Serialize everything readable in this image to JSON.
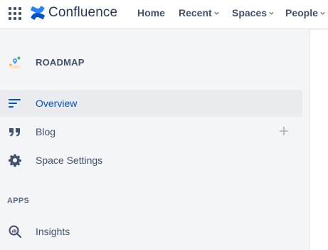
{
  "topbar": {
    "app_name": "Confluence",
    "nav": {
      "home": "Home",
      "recent": "Recent",
      "spaces": "Spaces",
      "people": "People"
    }
  },
  "space": {
    "name": "ROADMAP"
  },
  "sidebar": {
    "items": [
      {
        "label": "Overview",
        "icon": "overview-lines-icon",
        "active": true
      },
      {
        "label": "Blog",
        "icon": "quote-icon",
        "active": false
      },
      {
        "label": "Space Settings",
        "icon": "gear-icon",
        "active": false
      }
    ],
    "apps_section_label": "APPS",
    "apps": [
      {
        "label": "Insights",
        "icon": "insights-magnifier-icon"
      }
    ]
  },
  "colors": {
    "brand_blue": "#0052cc",
    "sidebar_bg": "#f4f5f7",
    "active_bg": "#ebecf0",
    "text": "#42526e"
  }
}
